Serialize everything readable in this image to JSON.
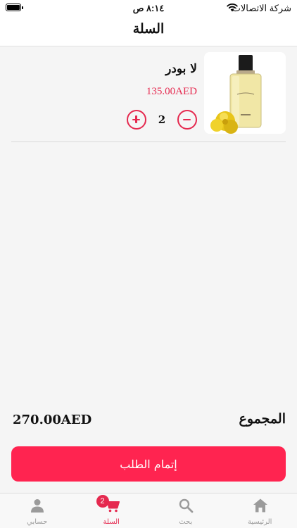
{
  "status_bar": {
    "time": "٨:١٤ ص",
    "carrier": "شركة الاتصالات",
    "wifi_icon": "wifi-icon",
    "battery_icon": "battery-icon"
  },
  "nav": {
    "title": "السلة"
  },
  "cart": {
    "items": [
      {
        "name": "لا بودر",
        "price": "135.00AED",
        "quantity": "2",
        "image_icon": "perfume-bottle-with-yellow-roses"
      }
    ]
  },
  "summary": {
    "total_label": "المجموع",
    "total_value": "270.00AED"
  },
  "checkout": {
    "label": "إتمام الطلب"
  },
  "tabs": {
    "home": {
      "label": "الرئيسية",
      "icon": "home-icon"
    },
    "search": {
      "label": "بحث",
      "icon": "search-icon"
    },
    "cart": {
      "label": "السلة",
      "icon": "cart-icon",
      "badge": "2"
    },
    "account": {
      "label": "حسابي",
      "icon": "person-icon"
    }
  },
  "colors": {
    "accent": "#ff2450",
    "price": "#e5294f",
    "inactive": "#9b9b9b"
  }
}
